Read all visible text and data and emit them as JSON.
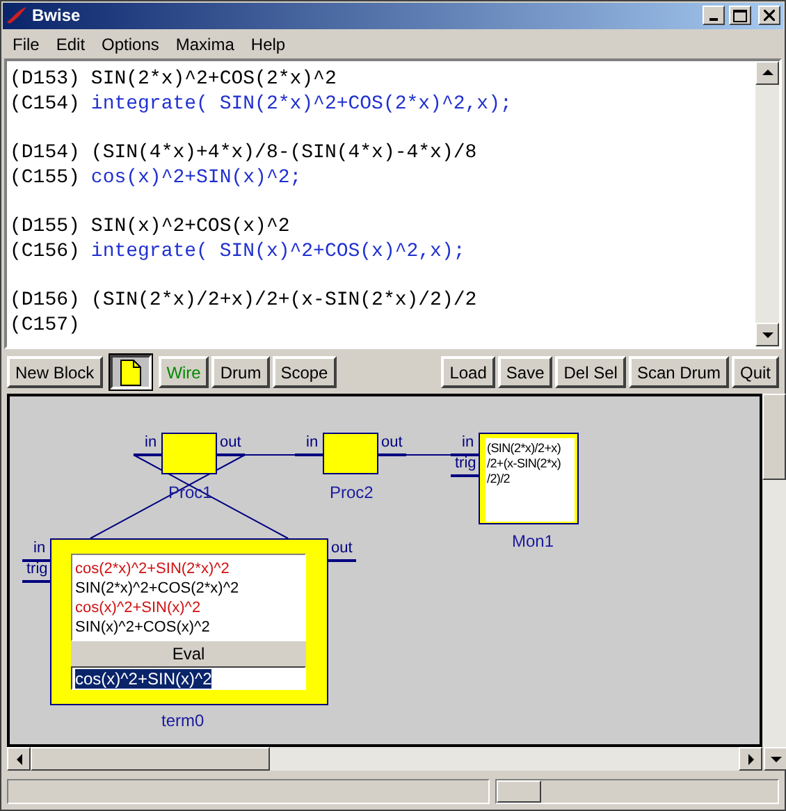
{
  "window": {
    "title": "Bwise"
  },
  "menu": [
    "File",
    "Edit",
    "Options",
    "Maxima",
    "Help"
  ],
  "console": {
    "groups": [
      {
        "lines": [
          {
            "label": "(D153)",
            "text": "SIN(2*x)^2+COS(2*x)^2",
            "kind": "output"
          },
          {
            "label": "(C154)",
            "text": "integrate( SIN(2*x)^2+COS(2*x)^2,x);",
            "kind": "input"
          }
        ]
      },
      {
        "lines": [
          {
            "label": "(D154)",
            "text": "(SIN(4*x)+4*x)/8-(SIN(4*x)-4*x)/8",
            "kind": "output"
          },
          {
            "label": "(C155)",
            "text": "cos(x)^2+SIN(x)^2;",
            "kind": "input"
          }
        ]
      },
      {
        "lines": [
          {
            "label": "(D155)",
            "text": "SIN(x)^2+COS(x)^2",
            "kind": "output"
          },
          {
            "label": "(C156)",
            "text": "integrate( SIN(x)^2+COS(x)^2,x);",
            "kind": "input"
          }
        ]
      },
      {
        "lines": [
          {
            "label": "(D156)",
            "text": "(SIN(2*x)/2+x)/2+(x-SIN(2*x)/2)/2",
            "kind": "output"
          },
          {
            "label": "(C157)"
          }
        ]
      }
    ]
  },
  "toolbar": {
    "left": [
      {
        "kind": "text",
        "label": "New Block",
        "pressed": false,
        "active": false
      },
      {
        "kind": "icon",
        "pressed": true,
        "active": false
      },
      {
        "kind": "text",
        "label": "Wire",
        "pressed": false,
        "active": true
      },
      {
        "kind": "text",
        "label": "Drum",
        "pressed": false,
        "active": false
      },
      {
        "kind": "text",
        "label": "Scope",
        "pressed": false,
        "active": false
      }
    ],
    "right": [
      {
        "kind": "text",
        "label": "Load",
        "pressed": false,
        "active": false
      },
      {
        "kind": "text",
        "label": "Save",
        "pressed": false,
        "active": false
      },
      {
        "kind": "text",
        "label": "Del Sel",
        "pressed": false,
        "active": false
      },
      {
        "kind": "text",
        "label": "Scan Drum",
        "pressed": false,
        "active": false
      },
      {
        "kind": "text",
        "label": "Quit",
        "pressed": false,
        "active": false
      }
    ]
  },
  "canvas": {
    "blocks": [
      {
        "kind": "proc",
        "name": "Proc1",
        "inputs": [
          "in"
        ],
        "outputs": [
          "out"
        ]
      },
      {
        "kind": "proc",
        "name": "Proc2",
        "inputs": [
          "in"
        ],
        "outputs": [
          "out"
        ]
      },
      {
        "kind": "monitor",
        "name": "Mon1",
        "inputs": [
          "in",
          "trig"
        ],
        "display": [
          "(SIN(2*x)/2+x)",
          "/2+(x-SIN(2*x)",
          "/2)/2"
        ]
      },
      {
        "kind": "terminal",
        "name": "term0",
        "inputs": [
          "in",
          "trig"
        ],
        "outputs": [
          "out"
        ],
        "history": [
          {
            "text": "cos(2*x)^2+SIN(2*x)^2",
            "kind": "input"
          },
          {
            "text": "SIN(2*x)^2+COS(2*x)^2",
            "kind": "output"
          },
          {
            "text": "cos(x)^2+SIN(x)^2",
            "kind": "input"
          },
          {
            "text": "SIN(x)^2+COS(x)^2",
            "kind": "output"
          }
        ],
        "button": "Eval",
        "entry": {
          "value": "cos(x)^2+SIN(x)^2",
          "text_selected": true
        }
      }
    ]
  },
  "status_slider": {
    "level": 0
  }
}
